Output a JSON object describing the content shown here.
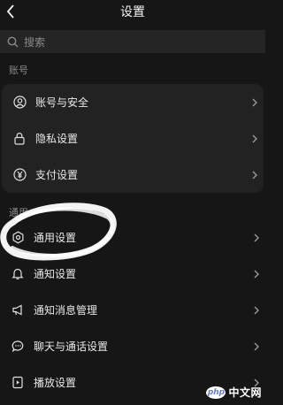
{
  "header": {
    "title": "设置",
    "back_icon": "chevron-left-icon"
  },
  "search": {
    "placeholder": "搜索",
    "icon": "search-icon"
  },
  "account_section": {
    "label": "账号",
    "items": [
      {
        "label": "账号与安全",
        "icon": "user-circle-icon"
      },
      {
        "label": "隐私设置",
        "icon": "lock-icon"
      },
      {
        "label": "支付设置",
        "icon": "yen-circle-icon"
      }
    ]
  },
  "general_section": {
    "label": "通用",
    "items": [
      {
        "label": "通用设置",
        "icon": "gear-icon"
      },
      {
        "label": "通知设置",
        "icon": "bell-icon"
      },
      {
        "label": "通知消息管理",
        "icon": "megaphone-icon"
      },
      {
        "label": "聊天与通话设置",
        "icon": "chat-bubble-icon"
      },
      {
        "label": "播放设置",
        "icon": "play-file-icon"
      }
    ]
  },
  "watermark": {
    "logo": "php",
    "text": "中文网"
  },
  "colors": {
    "background": "#161616",
    "card": "#222222",
    "text": "#e8e8e8",
    "muted": "#8a8a8a",
    "scribble": "#ffffff"
  }
}
